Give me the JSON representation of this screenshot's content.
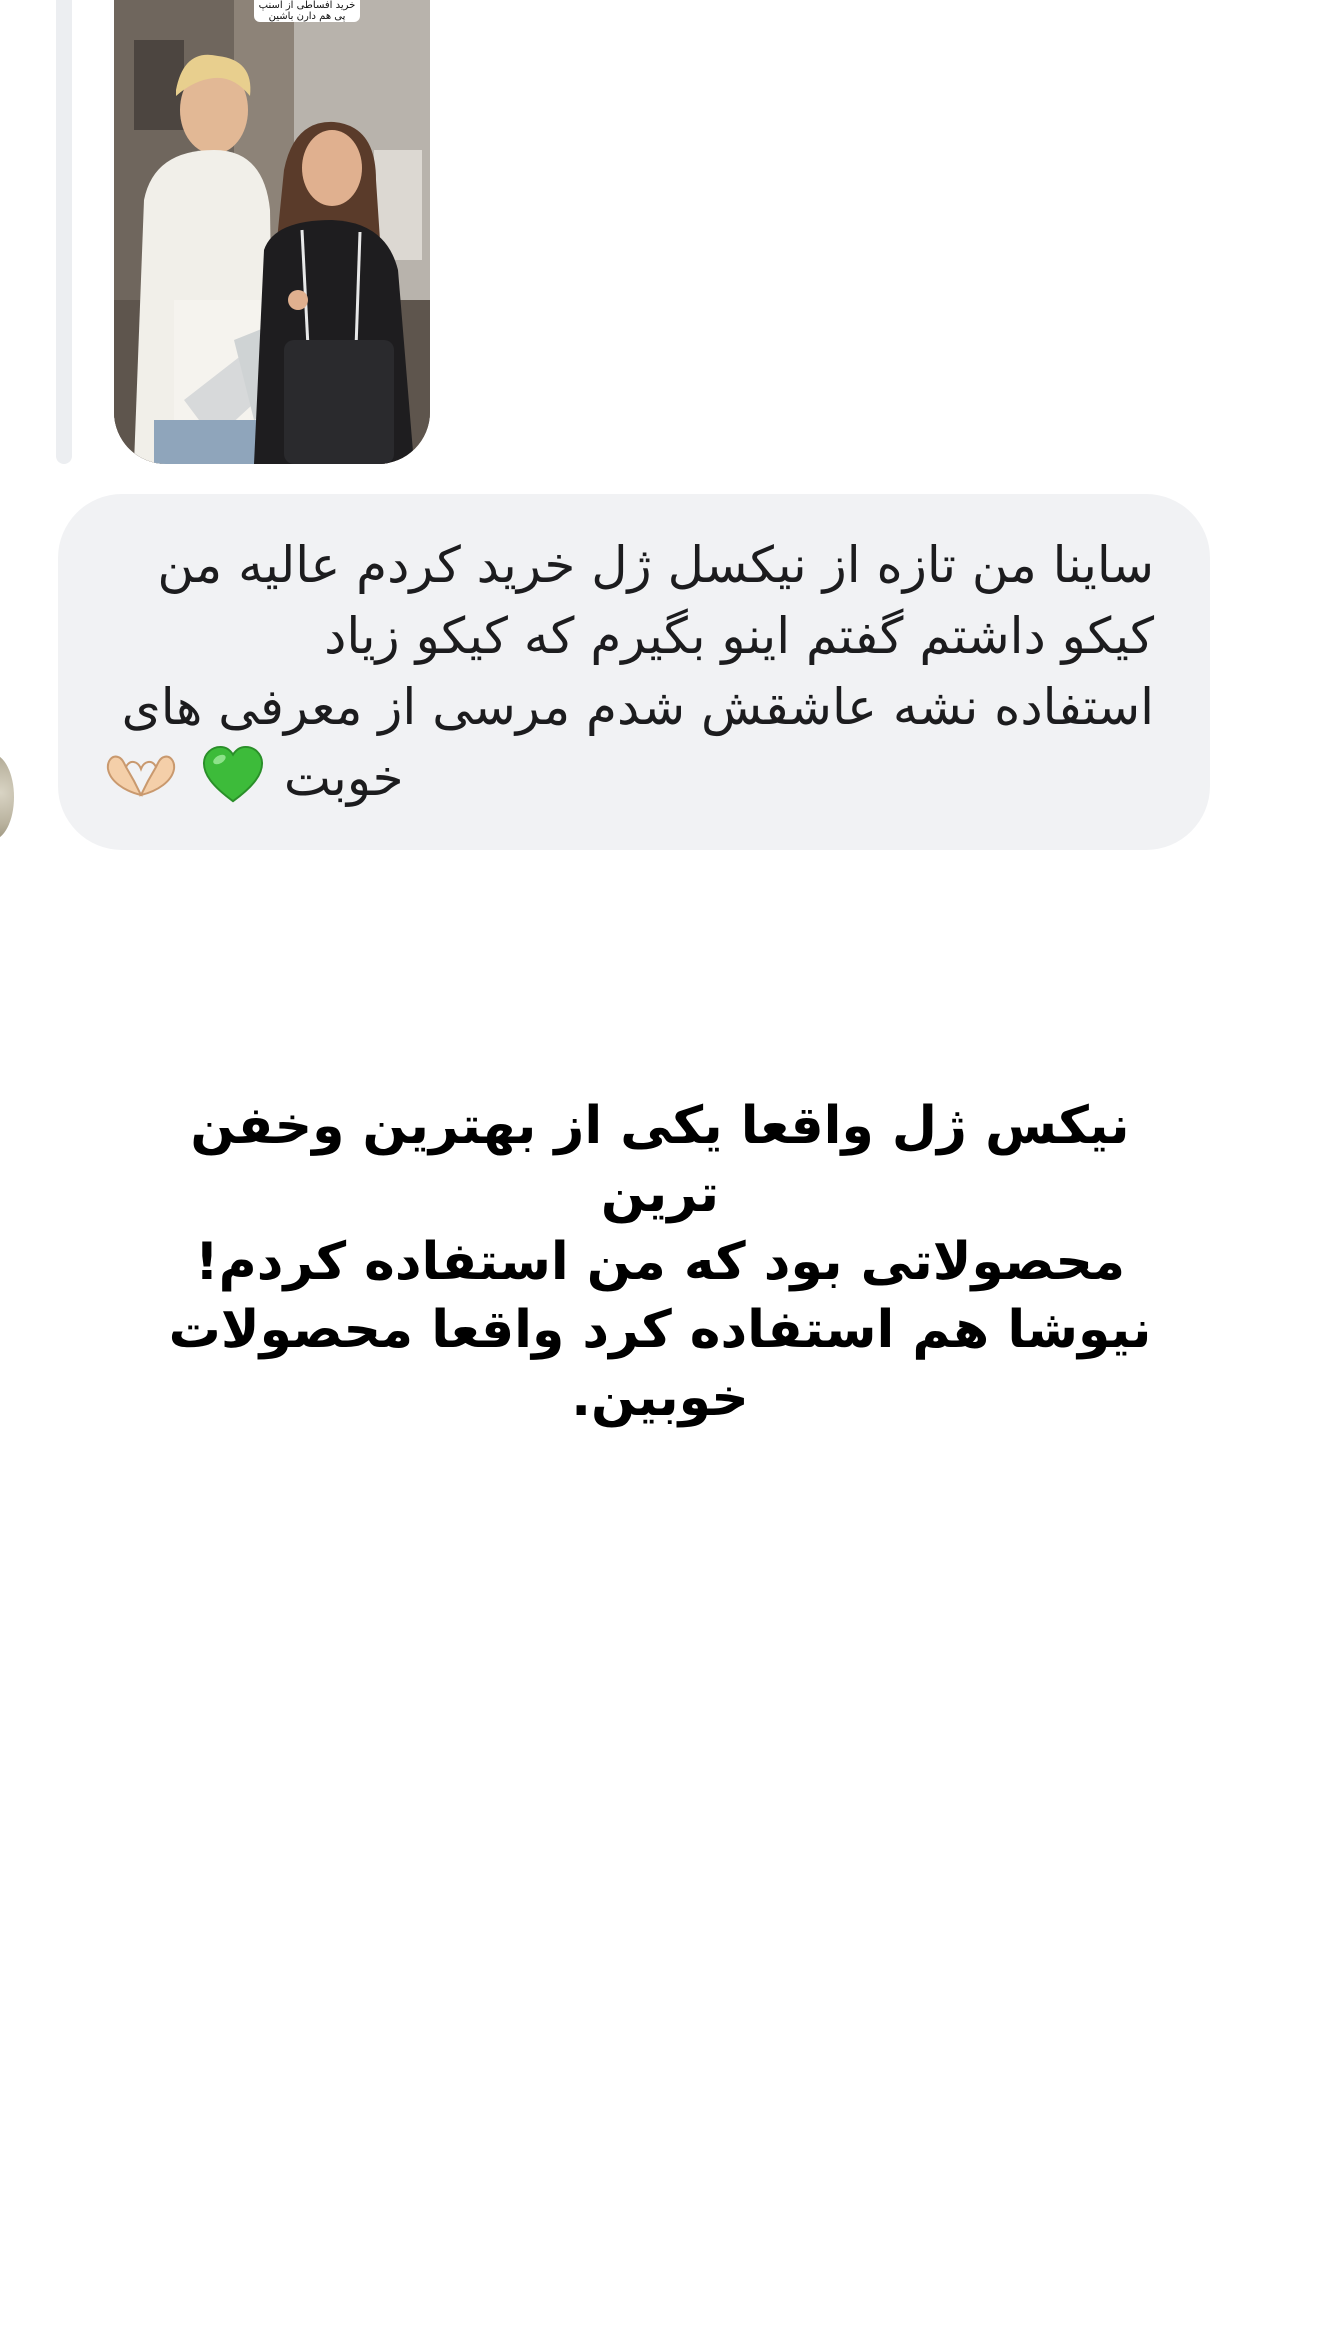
{
  "story": {
    "caption": "خرید افساطی از اسنپ پی هم دارن باشین"
  },
  "message": {
    "lines": [
      "ساینا من تازه از نیکسل ژل خرید کردم عالیه من",
      "کیکو داشتم گفتم اینو بگیرم که کیکو زیاد",
      "استفاده نشه عاشقش شدم مرسی از معرفی های"
    ],
    "last_line": "خوبت",
    "emojis": [
      "green-heart-icon",
      "heart-hands-icon"
    ],
    "bubble_color": "#f1f2f4"
  },
  "caption": {
    "text": "نیکس ژل واقعا یکی از بهترین وخفن ترین\nمحصولاتی بود که من استفاده کردم!\nنیوشا هم استفاده کرد واقعا محصولات\nخوبین."
  }
}
